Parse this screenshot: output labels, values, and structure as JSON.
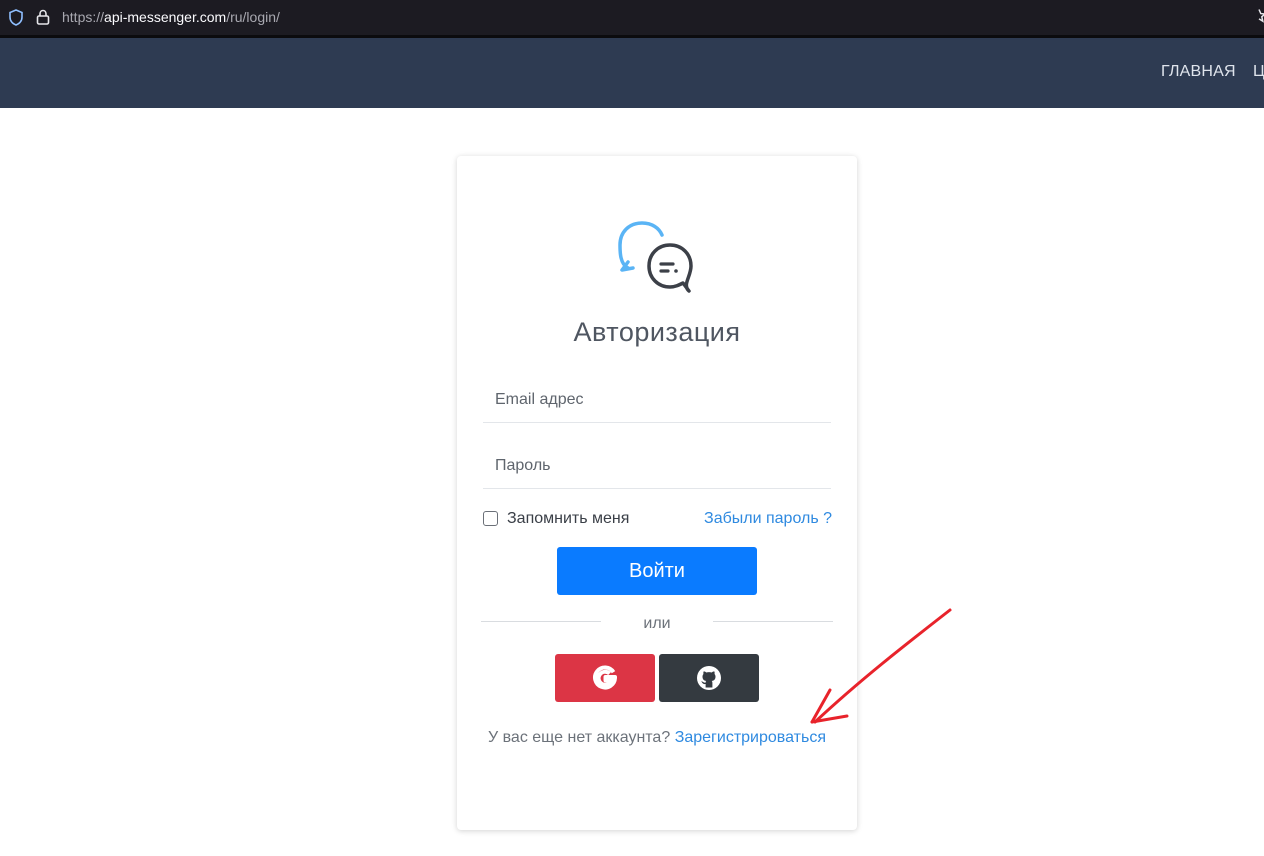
{
  "browser": {
    "url_prefix": "https://",
    "url_domain": "api-messenger.com",
    "url_path": "/ru/login/"
  },
  "nav": {
    "home": "ГЛАВНАЯ",
    "next_partial": "Ц"
  },
  "login": {
    "title": "Авторизация",
    "email_placeholder": "Email адрес",
    "password_placeholder": "Пароль",
    "remember_label": "Запомнить меня",
    "forgot_link": "Забыли пароль ?",
    "submit_label": "Войти",
    "or_text": "или",
    "signup_prompt": "У вас еще нет аккаунта?",
    "signup_link": "Зарегистрироваться"
  },
  "colors": {
    "header_bg": "#2e3b52",
    "primary": "#0a7bff",
    "google": "#dc3545",
    "github": "#343a40",
    "link": "#2f8ae0",
    "annotation_arrow": "#e8232b"
  }
}
